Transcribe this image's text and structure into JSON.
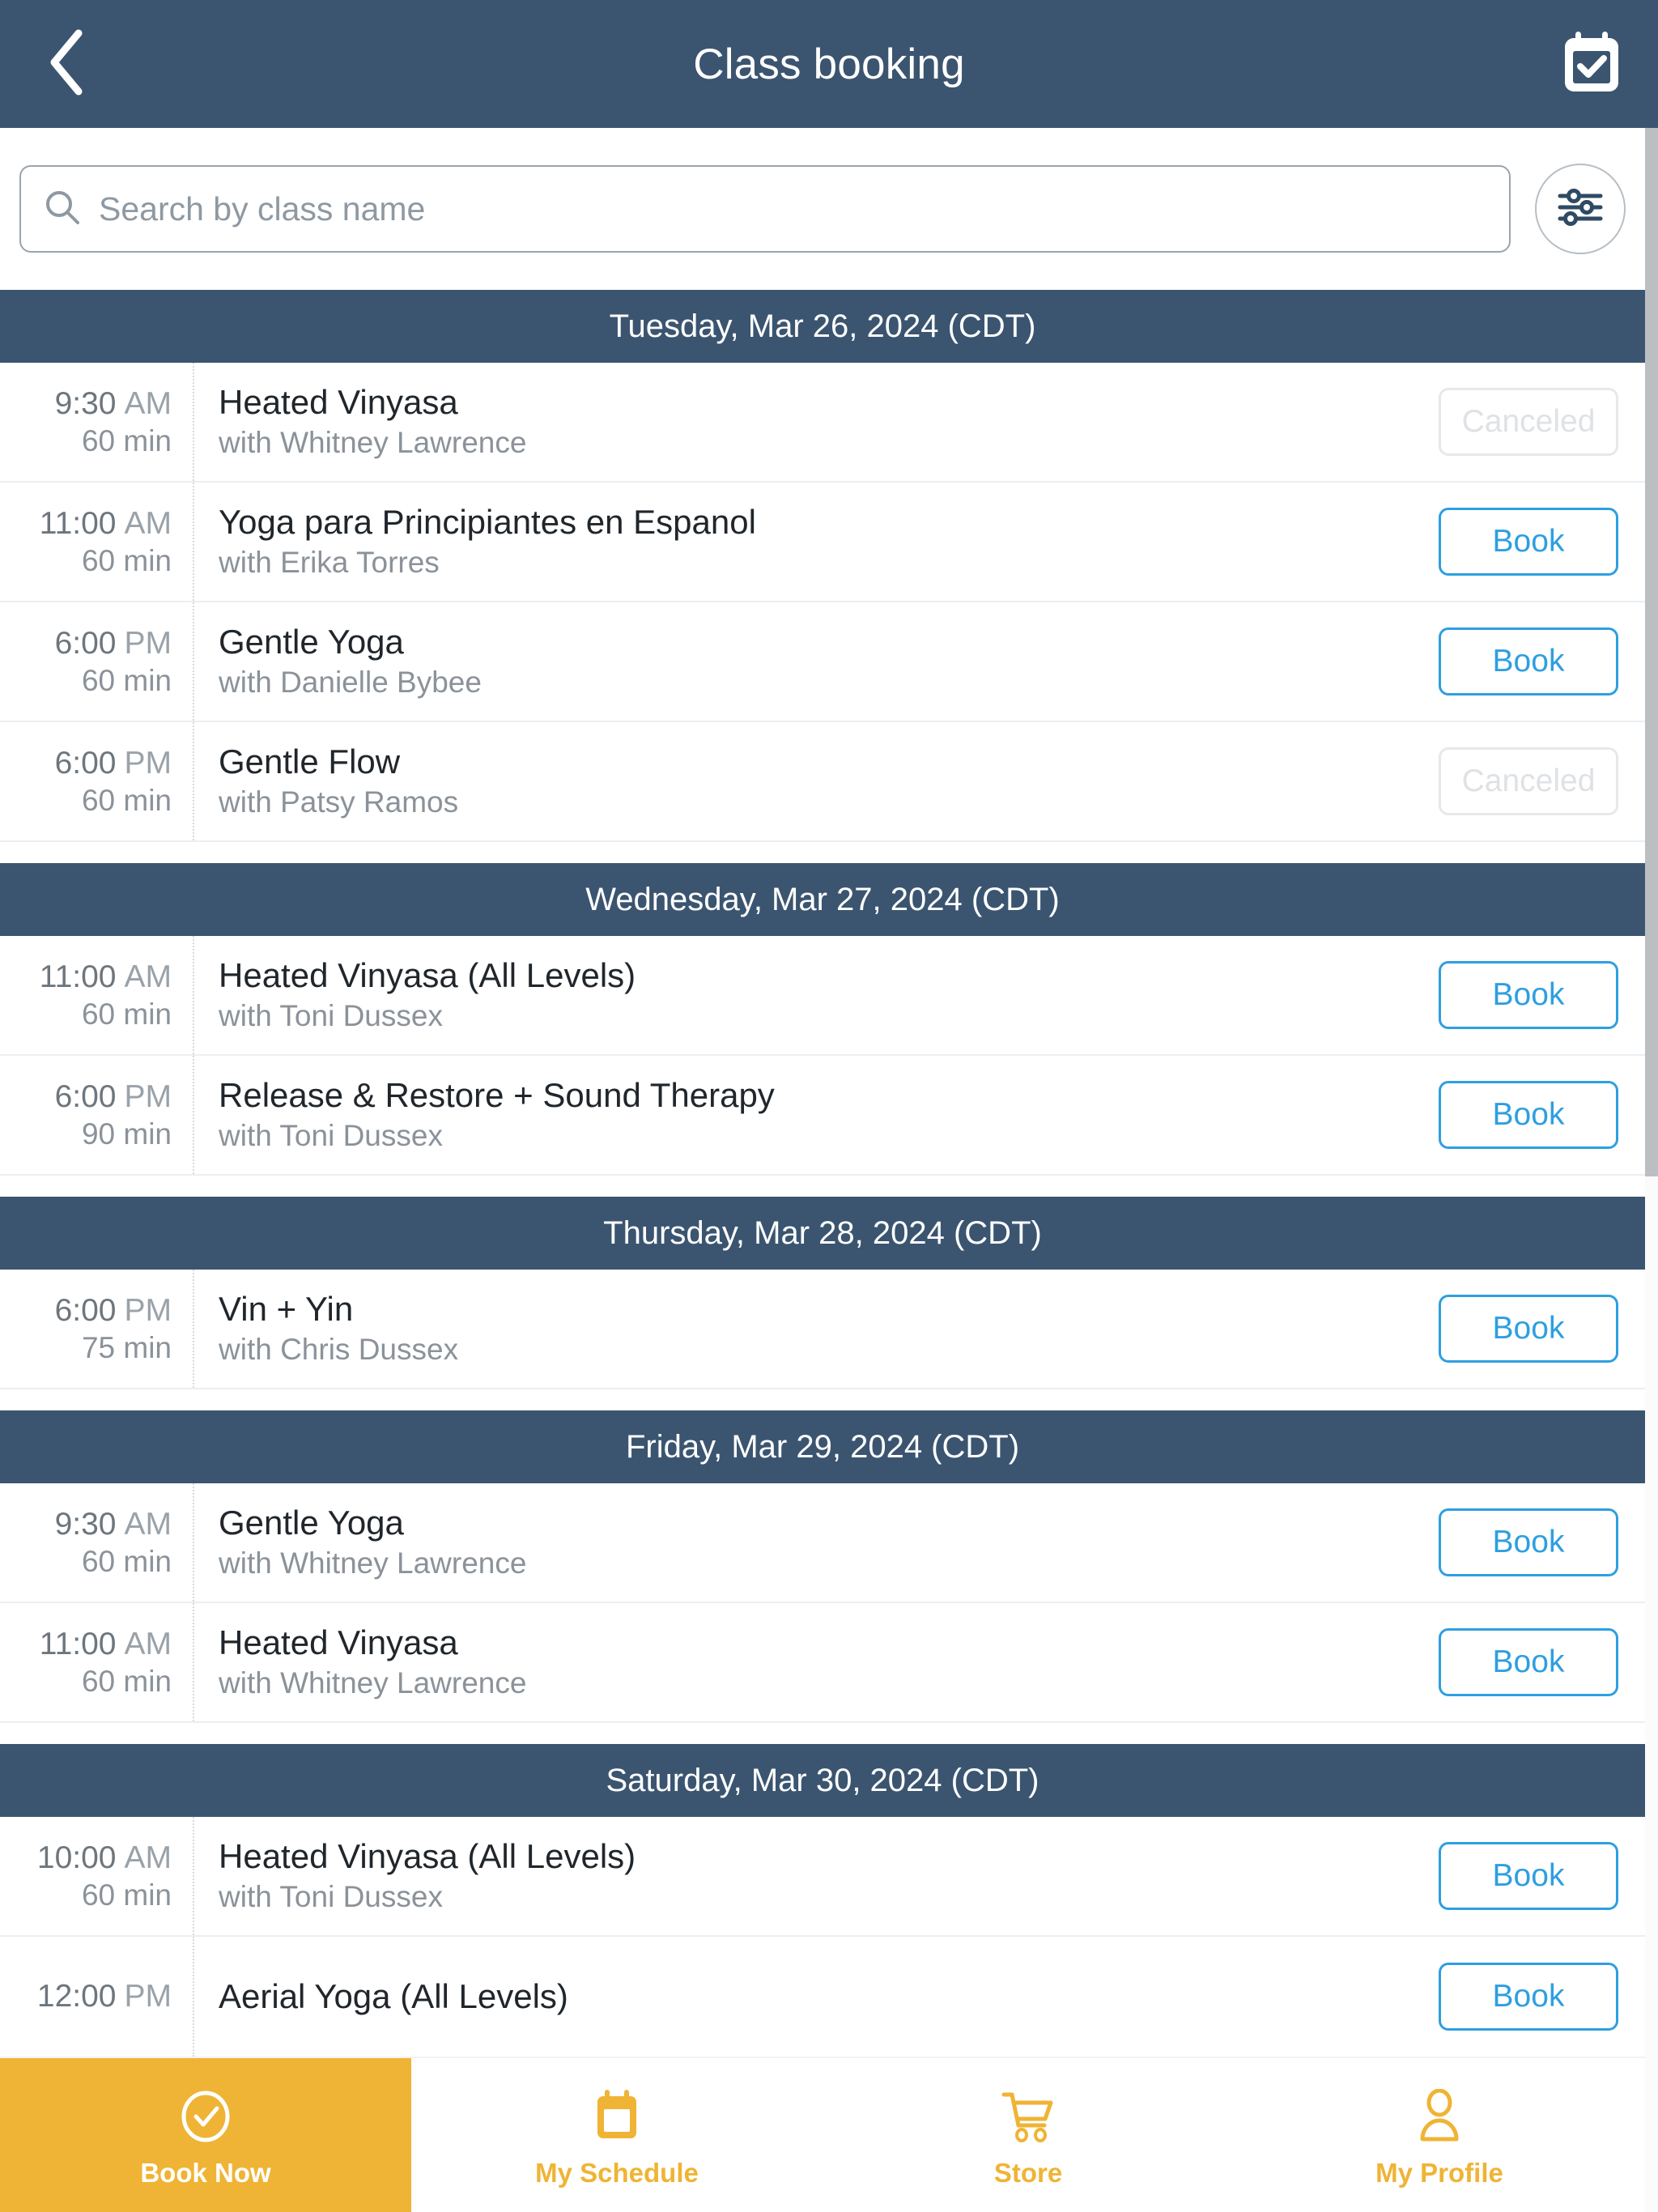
{
  "header": {
    "back_icon": "chevron-left-icon",
    "title": "Class booking",
    "calendar_icon": "calendar-check-icon",
    "bg_color": "#3B5570"
  },
  "search": {
    "placeholder": "Search by class name",
    "value": "",
    "search_icon": "search-icon",
    "filter_icon": "filter-sliders-icon"
  },
  "labels": {
    "book": "Book",
    "canceled": "Canceled",
    "with_prefix": "with "
  },
  "colors": {
    "navy": "#3B5570",
    "amber": "#EFB435",
    "book_blue": "#2E9FE0",
    "canceled_gray": "#DFE2E5"
  },
  "schedule": [
    {
      "date_label": "Tuesday, Mar 26, 2024 (CDT)",
      "classes": [
        {
          "time": "9:30",
          "ampm": "AM",
          "duration": "60 min",
          "name": "Heated Vinyasa",
          "teacher": "with Whitney Lawrence",
          "action": "Canceled",
          "state": "canceled"
        },
        {
          "time": "11:00",
          "ampm": "AM",
          "duration": "60 min",
          "name": "Yoga para Principiantes en Espanol",
          "teacher": "with Erika Torres",
          "action": "Book",
          "state": "bookable"
        },
        {
          "time": "6:00",
          "ampm": "PM",
          "duration": "60 min",
          "name": "Gentle Yoga",
          "teacher": "with Danielle Bybee",
          "action": "Book",
          "state": "bookable"
        },
        {
          "time": "6:00",
          "ampm": "PM",
          "duration": "60 min",
          "name": "Gentle Flow",
          "teacher": "with Patsy Ramos",
          "action": "Canceled",
          "state": "canceled"
        }
      ]
    },
    {
      "date_label": "Wednesday, Mar 27, 2024 (CDT)",
      "classes": [
        {
          "time": "11:00",
          "ampm": "AM",
          "duration": "60 min",
          "name": "Heated Vinyasa (All Levels)",
          "teacher": "with Toni Dussex",
          "action": "Book",
          "state": "bookable"
        },
        {
          "time": "6:00",
          "ampm": "PM",
          "duration": "90 min",
          "name": "Release & Restore + Sound Therapy",
          "teacher": "with Toni Dussex",
          "action": "Book",
          "state": "bookable"
        }
      ]
    },
    {
      "date_label": "Thursday, Mar 28, 2024 (CDT)",
      "classes": [
        {
          "time": "6:00",
          "ampm": "PM",
          "duration": "75 min",
          "name": "Vin + Yin",
          "teacher": "with Chris Dussex",
          "action": "Book",
          "state": "bookable"
        }
      ]
    },
    {
      "date_label": "Friday, Mar 29, 2024 (CDT)",
      "classes": [
        {
          "time": "9:30",
          "ampm": "AM",
          "duration": "60 min",
          "name": "Gentle Yoga",
          "teacher": "with Whitney Lawrence",
          "action": "Book",
          "state": "bookable"
        },
        {
          "time": "11:00",
          "ampm": "AM",
          "duration": "60 min",
          "name": "Heated Vinyasa",
          "teacher": "with Whitney Lawrence",
          "action": "Book",
          "state": "bookable"
        }
      ]
    },
    {
      "date_label": "Saturday, Mar 30, 2024 (CDT)",
      "classes": [
        {
          "time": "10:00",
          "ampm": "AM",
          "duration": "60 min",
          "name": "Heated Vinyasa (All Levels)",
          "teacher": "with Toni Dussex",
          "action": "Book",
          "state": "bookable"
        },
        {
          "time": "12:00",
          "ampm": "PM",
          "duration": "",
          "name": "Aerial Yoga (All Levels)",
          "teacher": "",
          "action": "Book",
          "state": "bookable"
        }
      ]
    }
  ],
  "bottom_nav": [
    {
      "label": "Book Now",
      "icon": "check-circle-icon",
      "active": true
    },
    {
      "label": "My Schedule",
      "icon": "calendar-icon",
      "active": false
    },
    {
      "label": "Store",
      "icon": "shopping-cart-icon",
      "active": false
    },
    {
      "label": "My Profile",
      "icon": "person-icon",
      "active": false
    }
  ]
}
